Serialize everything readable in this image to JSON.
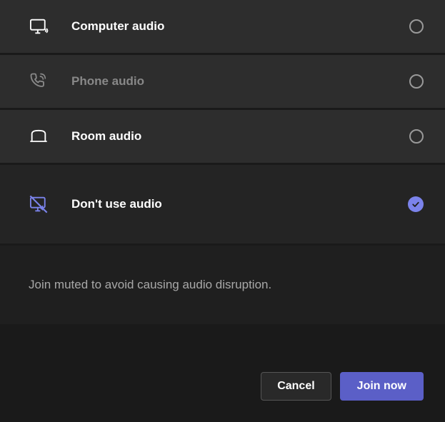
{
  "audio_options": {
    "computer": {
      "label": "Computer audio",
      "selected": false,
      "enabled": true
    },
    "phone": {
      "label": "Phone audio",
      "selected": false,
      "enabled": false
    },
    "room": {
      "label": "Room audio",
      "selected": false,
      "enabled": true
    },
    "none": {
      "label": "Don't use audio",
      "selected": true,
      "enabled": true
    }
  },
  "info_message": "Join muted to avoid causing audio disruption.",
  "buttons": {
    "cancel": "Cancel",
    "join": "Join now"
  },
  "colors": {
    "accent": "#7b83eb",
    "primary_button": "#5b5fc7"
  }
}
